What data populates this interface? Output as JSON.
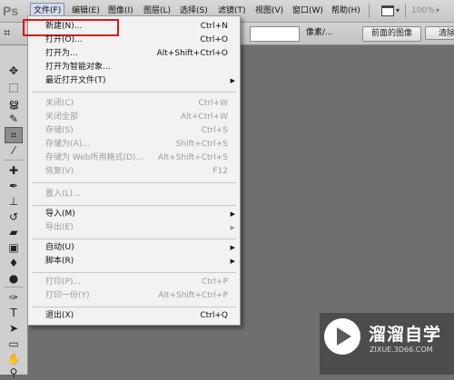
{
  "app": {
    "logo": "Ps"
  },
  "menubar": {
    "items": [
      {
        "label": "文件(F)",
        "active": true
      },
      {
        "label": "编辑(E)"
      },
      {
        "label": "图像(I)"
      },
      {
        "label": "图层(L)"
      },
      {
        "label": "选择(S)"
      },
      {
        "label": "滤镜(T)"
      },
      {
        "label": "视图(V)"
      },
      {
        "label": "窗口(W)"
      },
      {
        "label": "帮助(H)"
      }
    ],
    "zoom": "100%",
    "workspace_icon": "workspace-icon"
  },
  "options_bar": {
    "units": "像素/...",
    "front_image_button": "前面的图像",
    "clear_button": "清除"
  },
  "file_menu": {
    "rows": [
      {
        "label": "新建(N)...",
        "shortcut": "Ctrl+N"
      },
      {
        "label": "打开(O)...",
        "shortcut": "Ctrl+O"
      },
      {
        "label": "打开为...",
        "shortcut": "Alt+Shift+Ctrl+O"
      },
      {
        "label": "打开为智能对象..."
      },
      {
        "label": "最近打开文件(T)",
        "submenu": true
      },
      {
        "label": "关闭(C)",
        "shortcut": "Ctrl+W",
        "disabled": true
      },
      {
        "label": "关闭全部",
        "shortcut": "Alt+Ctrl+W",
        "disabled": true
      },
      {
        "label": "存储(S)",
        "shortcut": "Ctrl+S",
        "disabled": true
      },
      {
        "label": "存储为(A)...",
        "shortcut": "Shift+Ctrl+S",
        "disabled": true
      },
      {
        "label": "存储为 Web所用格式(D)...",
        "shortcut": "Alt+Shift+Ctrl+S",
        "disabled": true
      },
      {
        "label": "恢复(V)",
        "shortcut": "F12",
        "disabled": true
      },
      {
        "label": "置入(L)...",
        "disabled": true
      },
      {
        "label": "导入(M)",
        "submenu": true
      },
      {
        "label": "导出(E)",
        "submenu": true,
        "disabled": true
      },
      {
        "label": "自动(U)",
        "submenu": true
      },
      {
        "label": "脚本(R)",
        "submenu": true
      },
      {
        "label": "打印(P)...",
        "shortcut": "Ctrl+P",
        "disabled": true
      },
      {
        "label": "打印一份(Y)",
        "shortcut": "Alt+Shift+Ctrl+P",
        "disabled": true
      },
      {
        "label": "退出(X)",
        "shortcut": "Ctrl+Q"
      }
    ],
    "highlight_color": "#e0131a"
  },
  "toolbar": {
    "tools": [
      "move-tool-icon",
      "marquee-tool-icon",
      "lasso-tool-icon",
      "quick-select-tool-icon",
      "crop-tool-icon",
      "eyedropper-tool-icon",
      "healing-brush-tool-icon",
      "brush-tool-icon",
      "clone-stamp-tool-icon",
      "history-brush-tool-icon",
      "eraser-tool-icon",
      "gradient-tool-icon",
      "blur-tool-icon",
      "dodge-tool-icon",
      "pen-tool-icon",
      "type-tool-icon",
      "path-select-tool-icon",
      "shape-tool-icon",
      "hand-tool-icon",
      "zoom-tool-icon"
    ]
  },
  "watermark": {
    "title": "溜溜自学",
    "url": "ZIXUE.3D66.COM"
  }
}
